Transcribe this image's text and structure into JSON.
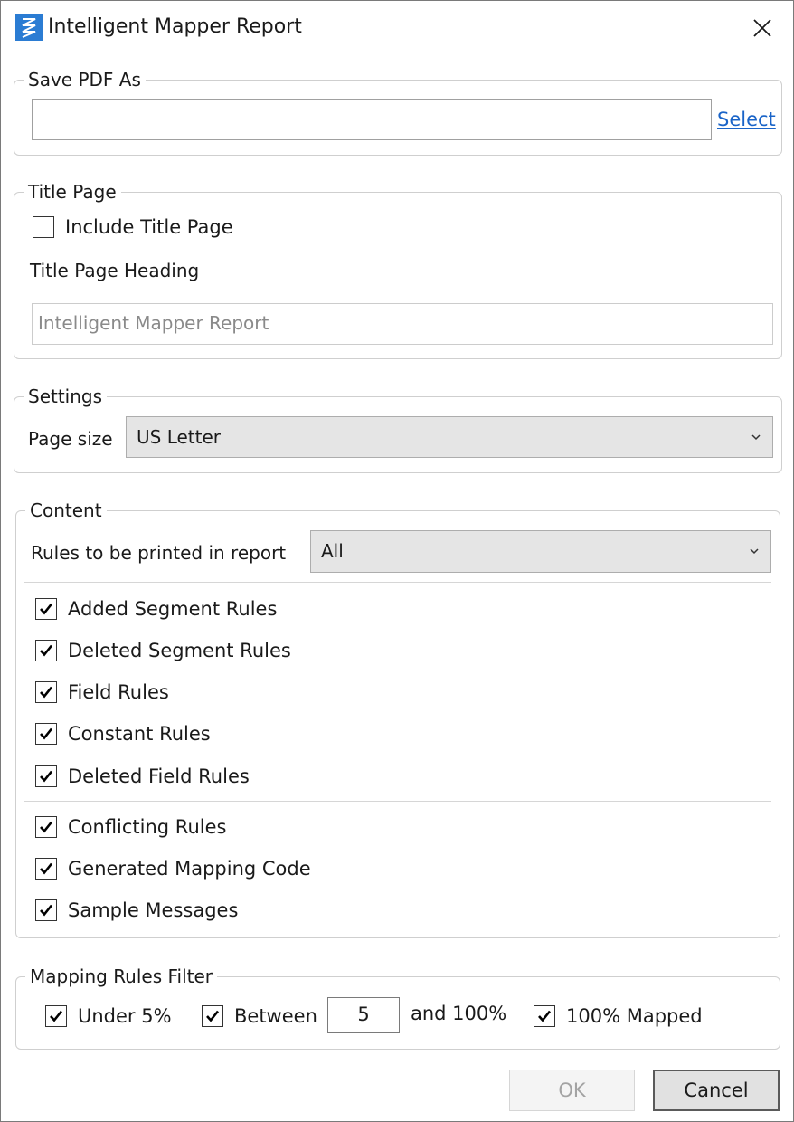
{
  "window": {
    "title": "Intelligent Mapper Report",
    "icon": "app-logo-icon",
    "accent_color": "#2b7cd3"
  },
  "save_pdf": {
    "legend": "Save PDF As",
    "path_value": "",
    "select_link": "Select"
  },
  "title_page": {
    "legend": "Title Page",
    "include_label": "Include Title Page",
    "include_checked": false,
    "heading_label": "Title Page Heading",
    "heading_placeholder": "Intelligent Mapper Report"
  },
  "settings": {
    "legend": "Settings",
    "page_size_label": "Page size",
    "page_size_value": "US Letter"
  },
  "content": {
    "legend": "Content",
    "rules_label": "Rules to be printed in report",
    "rules_value": "All",
    "items_group1": [
      {
        "label": "Added Segment Rules",
        "checked": true
      },
      {
        "label": "Deleted Segment Rules",
        "checked": true
      },
      {
        "label": "Field Rules",
        "checked": true
      },
      {
        "label": "Constant Rules",
        "checked": true
      },
      {
        "label": "Deleted Field Rules",
        "checked": true
      }
    ],
    "items_group2": [
      {
        "label": "Conflicting Rules",
        "checked": true
      },
      {
        "label": "Generated Mapping Code",
        "checked": true
      },
      {
        "label": "Sample Messages",
        "checked": true
      }
    ]
  },
  "filter": {
    "legend": "Mapping Rules Filter",
    "under_label": "Under 5%",
    "under_checked": true,
    "between_label": "Between",
    "between_checked": true,
    "between_value": "5",
    "and_label": "and 100%",
    "mapped_label": "100% Mapped",
    "mapped_checked": true
  },
  "buttons": {
    "ok": "OK",
    "cancel": "Cancel"
  }
}
